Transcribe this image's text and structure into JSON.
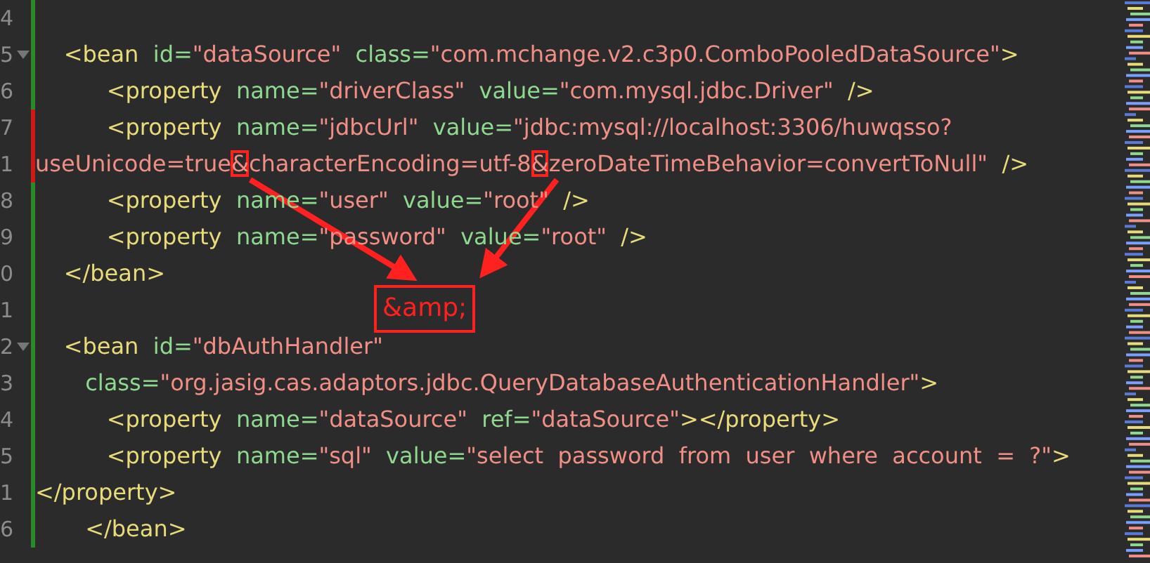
{
  "editor": {
    "lines": [
      {
        "number": "4",
        "color": "#2a8a2a",
        "foldable": false
      },
      {
        "number": "5",
        "color": "#2a8a2a",
        "foldable": true,
        "tokens": [
          {
            "kind": "tag",
            "text": "    <bean"
          },
          {
            "kind": "attr",
            "text": "  id="
          },
          {
            "kind": "value",
            "text": "\"dataSource\""
          },
          {
            "kind": "attr",
            "text": "  class="
          },
          {
            "kind": "value",
            "text": "\"com.mchange.v2.c3p0.ComboPooledDataSource\""
          },
          {
            "kind": "tag",
            "text": ">"
          }
        ]
      },
      {
        "number": "6",
        "color": "#2a8a2a",
        "foldable": false,
        "tokens": [
          {
            "kind": "tag",
            "text": "          <property"
          },
          {
            "kind": "attr",
            "text": "  name="
          },
          {
            "kind": "value",
            "text": "\"driverClass\""
          },
          {
            "kind": "attr",
            "text": "  value="
          },
          {
            "kind": "value",
            "text": "\"com.mysql.jdbc.Driver\""
          },
          {
            "kind": "tag",
            "text": "  />"
          }
        ]
      },
      {
        "number": "7",
        "color": "#d01818",
        "foldable": false,
        "tokens": [
          {
            "kind": "tag",
            "text": "          <property"
          },
          {
            "kind": "attr",
            "text": "  name="
          },
          {
            "kind": "value",
            "text": "\"jdbcUrl\""
          },
          {
            "kind": "attr",
            "text": "  value="
          },
          {
            "kind": "value",
            "text": "\"jdbc:mysql://localhost:3306/huwqsso?"
          }
        ]
      },
      {
        "number": "1",
        "color": "#d01818",
        "foldable": false,
        "tokens": [
          {
            "kind": "value",
            "text": "useUnicode=true"
          },
          {
            "kind": "value",
            "text": "&",
            "highlighted": true
          },
          {
            "kind": "value",
            "text": "characterEncoding=utf-8"
          },
          {
            "kind": "value",
            "text": "&",
            "highlighted": true
          },
          {
            "kind": "value",
            "text": "zeroDateTimeBehavior=convertToNull\""
          },
          {
            "kind": "tag",
            "text": "  />"
          }
        ]
      },
      {
        "number": "8",
        "color": "#2a8a2a",
        "foldable": false,
        "tokens": [
          {
            "kind": "tag",
            "text": "          <property"
          },
          {
            "kind": "attr",
            "text": "  name="
          },
          {
            "kind": "value",
            "text": "\"user\""
          },
          {
            "kind": "attr",
            "text": "  value="
          },
          {
            "kind": "value",
            "text": "\"root\""
          },
          {
            "kind": "tag",
            "text": "  />"
          }
        ]
      },
      {
        "number": "9",
        "color": "#2a8a2a",
        "foldable": false,
        "tokens": [
          {
            "kind": "tag",
            "text": "          <property"
          },
          {
            "kind": "attr",
            "text": "  name="
          },
          {
            "kind": "value",
            "text": "\"password\""
          },
          {
            "kind": "attr",
            "text": "  value="
          },
          {
            "kind": "value",
            "text": "\"root\""
          },
          {
            "kind": "tag",
            "text": "  />"
          }
        ]
      },
      {
        "number": "0",
        "color": "#2a8a2a",
        "foldable": false,
        "tokens": [
          {
            "kind": "tag",
            "text": "    </bean>"
          }
        ]
      },
      {
        "number": "1",
        "color": "#2a8a2a",
        "foldable": false
      },
      {
        "number": "2",
        "color": "#2a8a2a",
        "foldable": true,
        "tokens": [
          {
            "kind": "tag",
            "text": "    <bean"
          },
          {
            "kind": "attr",
            "text": "  id="
          },
          {
            "kind": "value",
            "text": "\"dbAuthHandler\""
          }
        ]
      },
      {
        "number": "3",
        "color": "#2a8a2a",
        "foldable": false,
        "tokens": [
          {
            "kind": "attr",
            "text": "       class="
          },
          {
            "kind": "value",
            "text": "\"org.jasig.cas.adaptors.jdbc.QueryDatabaseAuthenticationHandler\""
          },
          {
            "kind": "tag",
            "text": ">"
          }
        ]
      },
      {
        "number": "4",
        "color": "#2a8a2a",
        "foldable": false,
        "tokens": [
          {
            "kind": "tag",
            "text": "          <property"
          },
          {
            "kind": "attr",
            "text": "  name="
          },
          {
            "kind": "value",
            "text": "\"dataSource\""
          },
          {
            "kind": "attr",
            "text": "  ref="
          },
          {
            "kind": "value",
            "text": "\"dataSource\""
          },
          {
            "kind": "tag",
            "text": "></property>"
          }
        ]
      },
      {
        "number": "5",
        "color": "#2a8a2a",
        "foldable": false,
        "tokens": [
          {
            "kind": "tag",
            "text": "          <property"
          },
          {
            "kind": "attr",
            "text": "  name="
          },
          {
            "kind": "value",
            "text": "\"sql\""
          },
          {
            "kind": "attr",
            "text": "  value="
          },
          {
            "kind": "value",
            "text": "\"select  password  from  user  where  account  =  ?\""
          },
          {
            "kind": "tag",
            "text": ">"
          }
        ]
      },
      {
        "number": "1",
        "color": "#2a8a2a",
        "foldable": false,
        "tokens": [
          {
            "kind": "tag",
            "text": "</property>"
          }
        ]
      },
      {
        "number": "6",
        "color": "#2a8a2a",
        "foldable": false,
        "tokens": [
          {
            "kind": "tag",
            "text": "       </bean>"
          }
        ]
      }
    ]
  },
  "annotation": {
    "callout": "&amp;"
  }
}
